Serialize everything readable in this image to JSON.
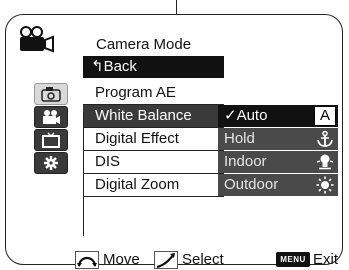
{
  "menu": {
    "title": "Camera Mode",
    "items": [
      {
        "label": "↰Back"
      },
      {
        "label": "Program AE"
      },
      {
        "label": "White Balance"
      },
      {
        "label": "Digital Effect"
      },
      {
        "label": "DIS"
      },
      {
        "label": "Digital Zoom"
      }
    ]
  },
  "submenu": {
    "items": [
      {
        "label": "✓Auto",
        "badge": "A",
        "icon": "auto-badge"
      },
      {
        "label": "Hold",
        "icon": "hold-icon"
      },
      {
        "label": "Indoor",
        "icon": "indoor-bulb-icon"
      },
      {
        "label": "Outdoor",
        "icon": "outdoor-sun-icon"
      }
    ]
  },
  "footer": {
    "move_label": "Move",
    "select_label": "Select",
    "menu_badge": "MENU",
    "exit_label": "Exit"
  },
  "colors": {
    "highlight": "#111111",
    "selected_row": "#3a3a3a",
    "option_bg": "#4a4a4a"
  }
}
